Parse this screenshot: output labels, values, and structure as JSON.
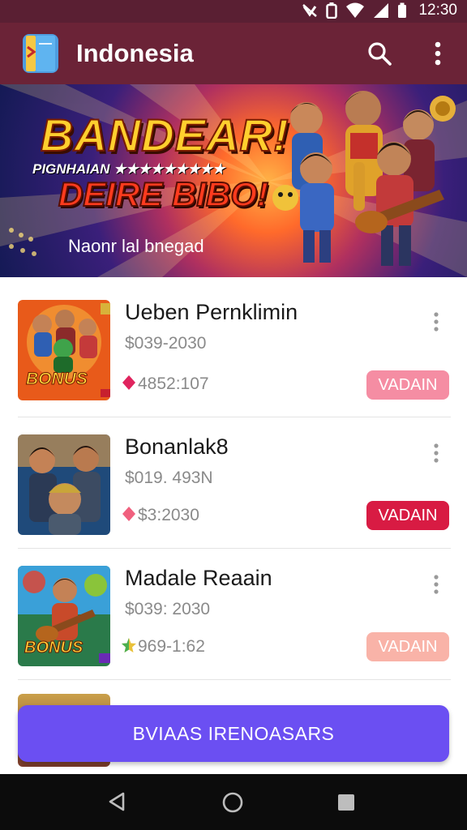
{
  "status_bar": {
    "time": "12:30",
    "icons": [
      "no-signal-icon",
      "battery-outline-icon",
      "wifi-icon",
      "cell-signal-icon",
      "battery-icon"
    ]
  },
  "app_bar": {
    "title": "Indonesia",
    "logo_icon": "book-app-icon",
    "actions": [
      "search-icon",
      "more-vert-icon"
    ],
    "background": "#6b2337"
  },
  "banner": {
    "title_line1": "BANDEAR!",
    "subtitle": "PIGNHAIAN ★★★★★★★★★",
    "title_line2": "DEIRE BIBO!",
    "caption": "Naonr lal bnegad"
  },
  "items": [
    {
      "title": "Ueben Pernklimin",
      "subtitle": "$039-2030",
      "stat": "4852:107",
      "stat_icon": "diamond-icon",
      "stat_icon_color": "#e0245e",
      "button_label": "VADAIN",
      "button_color": "#f58da3",
      "thumb_label": "BONUS"
    },
    {
      "title": "Bonanlak8",
      "subtitle": "$019. 493N",
      "stat": "$3:2030",
      "stat_icon": "diamond-icon",
      "stat_icon_color": "#f0607e",
      "button_label": "VADAIN",
      "button_color": "#d81b43",
      "thumb_label": ""
    },
    {
      "title": "Madale Reaain",
      "subtitle": "$039: 2030",
      "stat": "969-1:62",
      "stat_icon": "star-icon",
      "stat_icon_color": "#e9c13a",
      "button_label": "VADAIN",
      "button_color": "#f9b3a8",
      "thumb_label": "BONUS"
    }
  ],
  "cta": {
    "label": "BVIAAS IRENOASARS",
    "color": "#6b4ff2"
  },
  "nav_bar": {
    "icons": [
      "back-icon",
      "home-icon",
      "recents-icon"
    ]
  }
}
